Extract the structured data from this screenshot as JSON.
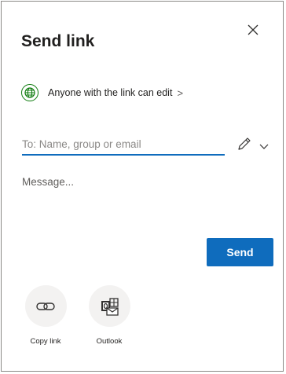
{
  "dialog": {
    "title": "Send link",
    "close_icon": "close-icon"
  },
  "permission": {
    "icon": "globe-icon",
    "icon_color": "#107c10",
    "label": "Anyone with the link can edit",
    "chevron": ">"
  },
  "recipients": {
    "value": "",
    "placeholder": "To: Name, group or email",
    "permission_icon": "pencil-icon",
    "dropdown_icon": "chevron-down-icon"
  },
  "message": {
    "value": "",
    "placeholder": "Message..."
  },
  "send": {
    "label": "Send",
    "color": "#0f6cbd"
  },
  "share_options": [
    {
      "label": "Copy link",
      "icon": "link-icon"
    },
    {
      "label": "Outlook",
      "icon": "outlook-icon"
    }
  ]
}
